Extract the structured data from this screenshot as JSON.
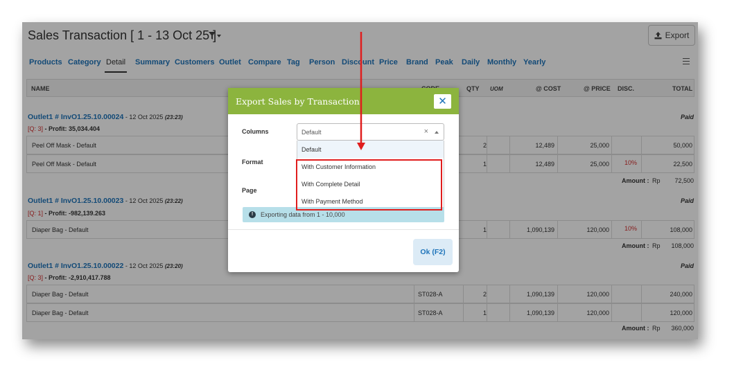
{
  "header": {
    "title": "Sales Transaction [ 1 - 13 Oct 25 ]",
    "export_label": "Export"
  },
  "tabs": [
    "Products",
    "Category",
    "Detail",
    "Summary",
    "Customers",
    "Outlet",
    "Compare",
    "Tag",
    "Person",
    "Discount",
    "Price",
    "Brand",
    "Peak",
    "Daily",
    "Monthly",
    "Yearly"
  ],
  "active_tab": "Detail",
  "table": {
    "columns": {
      "name": "NAME",
      "code": "CODE",
      "qty": "QTY",
      "uom": "UOM",
      "cost": "@ COST",
      "price": "@ PRICE",
      "disc": "DISC.",
      "total": "TOTAL"
    },
    "groups": [
      {
        "invoice": "Outlet1 # InvO1.25.10.00024",
        "date": " - 12 Oct 2025 ",
        "time": "(23:23)",
        "qty_tag": "[Q: 3]",
        "profit": " - Profit: 35,034.404",
        "status": "Paid",
        "rows": [
          {
            "name": "Peel Off Mask - Default",
            "code": "",
            "qty": "2",
            "cost": "12,489",
            "price": "25,000",
            "disc": "",
            "total": "50,000"
          },
          {
            "name": "Peel Off Mask - Default",
            "code": "",
            "qty": "1",
            "cost": "12,489",
            "price": "25,000",
            "disc": "10%",
            "total": "22,500"
          }
        ],
        "amount_label": "Amount :",
        "currency": "Rp",
        "amount": "72,500"
      },
      {
        "invoice": "Outlet1 # InvO1.25.10.00023",
        "date": " - 12 Oct 2025 ",
        "time": "(23:22)",
        "qty_tag": "[Q: 1]",
        "profit": " - Profit: -982,139.263",
        "status": "Paid",
        "rows": [
          {
            "name": "Diaper Bag - Default",
            "code": "",
            "qty": "1",
            "cost": "1,090,139",
            "price": "120,000",
            "disc": "10%",
            "total": "108,000"
          }
        ],
        "amount_label": "Amount :",
        "currency": "Rp",
        "amount": "108,000"
      },
      {
        "invoice": "Outlet1 # InvO1.25.10.00022",
        "date": " - 12 Oct 2025 ",
        "time": "(23:20)",
        "qty_tag": "[Q: 3]",
        "profit": " - Profit: -2,910,417.788",
        "status": "Paid",
        "rows": [
          {
            "name": "Diaper Bag - Default",
            "code": "ST028-A",
            "qty": "2",
            "cost": "1,090,139",
            "price": "120,000",
            "disc": "",
            "total": "240,000"
          },
          {
            "name": "Diaper Bag - Default",
            "code": "ST028-A",
            "qty": "1",
            "cost": "1,090,139",
            "price": "120,000",
            "disc": "",
            "total": "120,000"
          }
        ],
        "amount_label": "Amount :",
        "currency": "Rp",
        "amount": "360,000"
      }
    ]
  },
  "modal": {
    "title": "Export Sales by Transaction",
    "close_label": "✕",
    "columns_label": "Columns",
    "columns_value": "Default",
    "format_label": "Format",
    "page_label": "Page",
    "options": [
      "Default",
      "With Customer Information",
      "With Complete Detail",
      "With Payment Method"
    ],
    "info_icon": "!",
    "info_text": "Exporting data from 1 - 10,000",
    "ok_label": "Ok (F2)"
  },
  "colors": {
    "accent": "#1e74ba",
    "modal_header": "#8cb43e",
    "highlight": "#e01d1d",
    "discount": "#d32f2f"
  },
  "icons": [
    "filter-icon",
    "export-icon",
    "menu-icon",
    "close-icon",
    "info-icon",
    "arrow-annotation"
  ]
}
